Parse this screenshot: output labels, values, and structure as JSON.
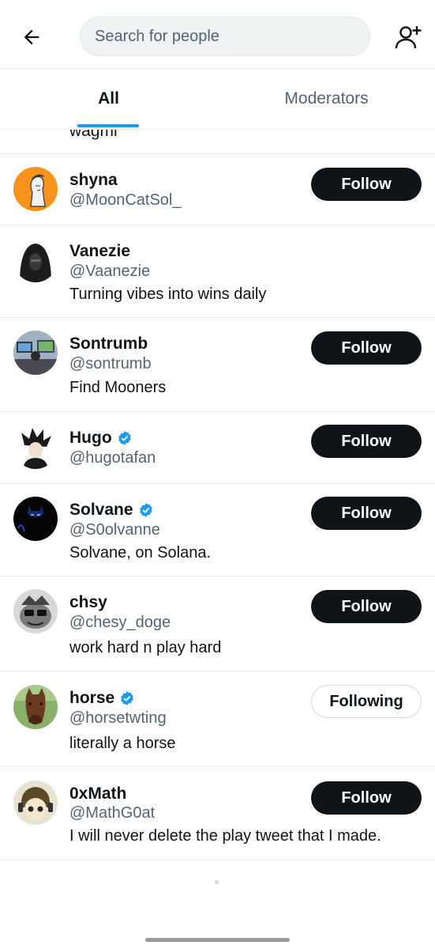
{
  "header": {
    "search_placeholder": "Search for people",
    "back_icon": "back-arrow-icon",
    "add_icon": "add-user-icon"
  },
  "tabs": [
    {
      "label": "All",
      "active": true
    },
    {
      "label": "Moderators",
      "active": false
    }
  ],
  "cutoff_text": "wagmi",
  "accent_color": "#1d9bf0",
  "users": [
    {
      "name": "shyna",
      "handle": "@MoonCatSol_",
      "bio": "",
      "verified": false,
      "button": "Follow"
    },
    {
      "name": "Vanezie",
      "handle": "@Vaanezie",
      "bio": "Turning vibes into wins daily",
      "verified": false,
      "button": ""
    },
    {
      "name": "Sontrumb",
      "handle": "@sontrumb",
      "bio": "Find Mooners",
      "verified": false,
      "button": "Follow"
    },
    {
      "name": "Hugo",
      "handle": "@hugotafan",
      "bio": "",
      "verified": true,
      "button": "Follow"
    },
    {
      "name": "Solvane",
      "handle": "@S0olvanne",
      "bio": "Solvane, on Solana.",
      "verified": true,
      "button": "Follow"
    },
    {
      "name": "chsy",
      "handle": "@chesy_doge",
      "bio": "work hard n play hard",
      "verified": false,
      "button": "Follow"
    },
    {
      "name": "horse",
      "handle": "@horsetwting",
      "bio": "literally a horse",
      "verified": true,
      "button": "Following"
    },
    {
      "name": "0xMath",
      "handle": "@MathG0at",
      "bio": "I will never delete the play tweet that I made.",
      "verified": false,
      "button": "Follow"
    }
  ]
}
